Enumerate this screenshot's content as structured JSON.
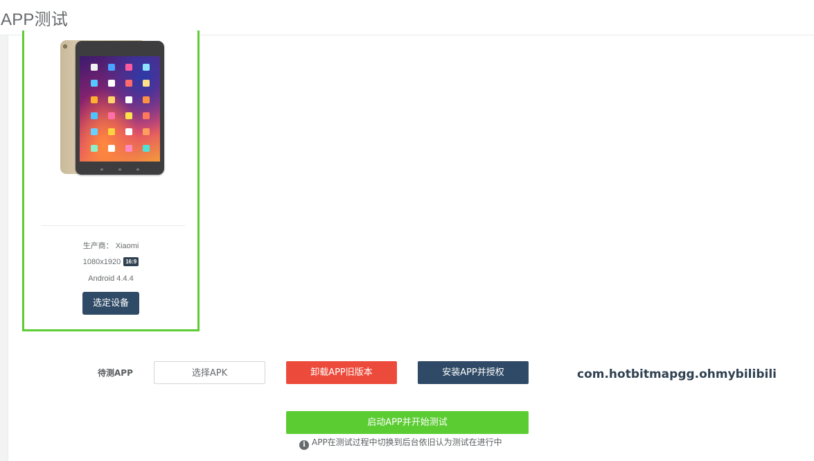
{
  "header": {
    "title": "APP测试"
  },
  "device": {
    "image_icon": "tablet-device-image",
    "manufacturer_label": "生产商： Xiaomi",
    "resolution": "1080x1920",
    "aspect_ratio": "16:9",
    "os_version": "Android 4.4.4",
    "select_button": "选定设备",
    "selected_border_color": "#5ccc33"
  },
  "app_test": {
    "pending_label": "待测APP",
    "choose_apk_button": "选择APK",
    "uninstall_button": "卸载APP旧版本",
    "install_button": "安装APP并授权",
    "package_name": "com.hotbitmapgg.ohmybilibili",
    "start_button": "启动APP并开始测试",
    "note_icon": "info-icon",
    "note": "APP在测试过程中切换到后台依旧认为测试在进行中"
  },
  "colors": {
    "primary": "#2f4a66",
    "danger": "#ec4b3b",
    "success": "#5ccc33"
  }
}
